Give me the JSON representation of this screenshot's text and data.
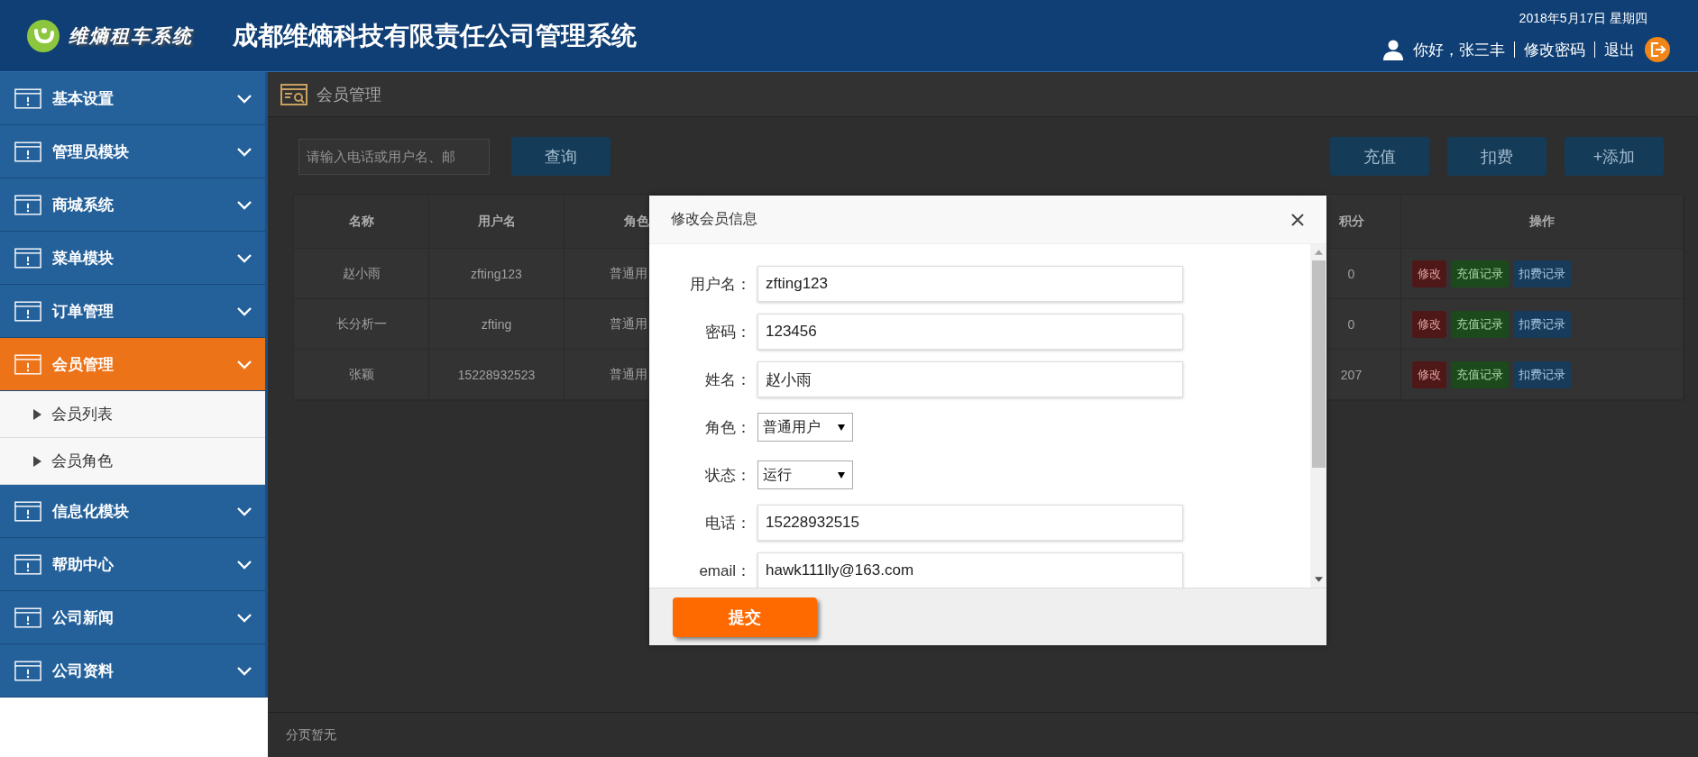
{
  "header": {
    "logo_text": "维熵租车系统",
    "title": "成都维熵科技有限责任公司管理系统",
    "date": "2018年5月17日 星期四",
    "greeting": "你好，张三丰",
    "change_password": "修改密码",
    "logout": "退出"
  },
  "sidebar": {
    "items": [
      {
        "label": "基本设置",
        "selected": false
      },
      {
        "label": "管理员模块",
        "selected": false
      },
      {
        "label": "商城系统",
        "selected": false
      },
      {
        "label": "菜单模块",
        "selected": false
      },
      {
        "label": "订单管理",
        "selected": false
      },
      {
        "label": "会员管理",
        "selected": true,
        "children": [
          {
            "label": "会员列表"
          },
          {
            "label": "会员角色"
          }
        ]
      },
      {
        "label": "信息化模块",
        "selected": false
      },
      {
        "label": "帮助中心",
        "selected": false
      },
      {
        "label": "公司新闻",
        "selected": false
      },
      {
        "label": "公司资料",
        "selected": false
      }
    ]
  },
  "breadcrumb": {
    "title": "会员管理"
  },
  "toolbar": {
    "search": {
      "placeholder": "请输入电话或用户名、邮"
    },
    "search_button": "查询",
    "actions": [
      "充值",
      "扣费",
      "+添加"
    ]
  },
  "table": {
    "columns": [
      "名称",
      "用户名",
      "角色",
      "积分",
      "操作"
    ],
    "rows": [
      {
        "name": "赵小雨",
        "username": "zfting123",
        "role": "普通用",
        "points": "0",
        "actions": [
          {
            "label": "修改",
            "kind": "edit"
          },
          {
            "label": "充值记录",
            "kind": "recharge"
          },
          {
            "label": "扣费记录",
            "kind": "deduct"
          }
        ]
      },
      {
        "name": "长分析一",
        "username": "zfting",
        "role": "普通用",
        "points": "0",
        "actions": [
          {
            "label": "修改",
            "kind": "edit"
          },
          {
            "label": "充值记录",
            "kind": "recharge"
          },
          {
            "label": "扣费记录",
            "kind": "deduct"
          }
        ]
      },
      {
        "name": "张颖",
        "username": "15228932523",
        "role": "普通用",
        "points": "207",
        "actions": [
          {
            "label": "修改",
            "kind": "edit"
          },
          {
            "label": "充值记录",
            "kind": "recharge"
          },
          {
            "label": "扣费记录",
            "kind": "deduct"
          }
        ]
      }
    ]
  },
  "modal": {
    "title": "修改会员信息",
    "fields": [
      {
        "label": "用户名：",
        "value": "zfting123",
        "kind": "text"
      },
      {
        "label": "密码：",
        "value": "123456",
        "kind": "text"
      },
      {
        "label": "姓名：",
        "value": "赵小雨",
        "kind": "text"
      },
      {
        "label": "角色：",
        "value": "普通用户",
        "kind": "select"
      },
      {
        "label": "状态：",
        "value": "运行",
        "kind": "select"
      },
      {
        "label": "电话：",
        "value": "15228932515",
        "kind": "text"
      },
      {
        "label": "email：",
        "value": "hawk111lly@163.com",
        "kind": "text"
      }
    ],
    "submit": "提交"
  },
  "footer": {
    "pagination": "分页暂无"
  }
}
